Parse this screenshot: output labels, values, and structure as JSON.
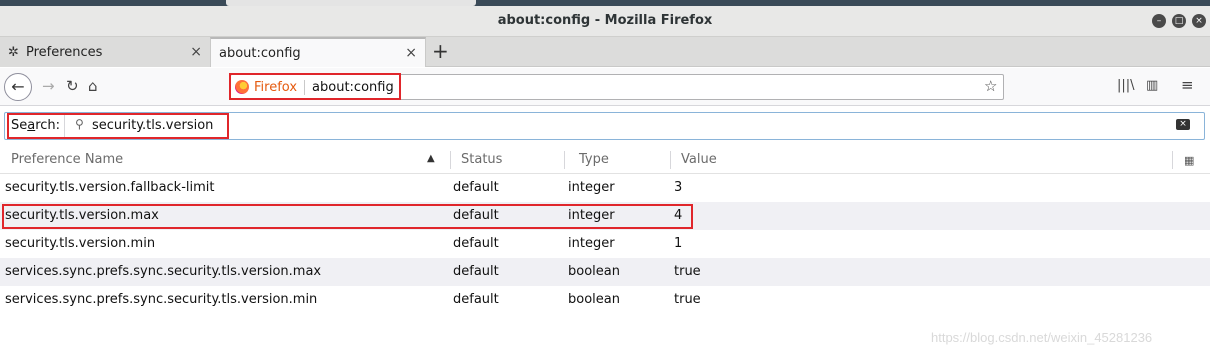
{
  "window": {
    "title": "about:config - Mozilla Firefox",
    "controls": [
      "minimize",
      "maximize",
      "close"
    ]
  },
  "tabs": [
    {
      "label": "Preferences",
      "icon": "gear-icon",
      "active": false
    },
    {
      "label": "about:config",
      "icon": null,
      "active": true
    }
  ],
  "navbar": {
    "identity_label": "Firefox",
    "url": "about:config"
  },
  "search": {
    "label": "Search:",
    "label_accesskey": "a",
    "value": "security.tls.version"
  },
  "table": {
    "columns": [
      "Preference Name",
      "Status",
      "Type",
      "Value"
    ],
    "sort_column": "Preference Name",
    "rows": [
      {
        "name": "security.tls.version.fallback-limit",
        "status": "default",
        "type": "integer",
        "value": "3"
      },
      {
        "name": "security.tls.version.max",
        "status": "default",
        "type": "integer",
        "value": "4"
      },
      {
        "name": "security.tls.version.min",
        "status": "default",
        "type": "integer",
        "value": "1"
      },
      {
        "name": "services.sync.prefs.sync.security.tls.version.max",
        "status": "default",
        "type": "boolean",
        "value": "true"
      },
      {
        "name": "services.sync.prefs.sync.security.tls.version.min",
        "status": "default",
        "type": "boolean",
        "value": "true"
      }
    ]
  },
  "watermark": "https://blog.csdn.net/weixin_45281236",
  "colors": {
    "highlight": "#e0262b",
    "firefox_orange": "#e55b10",
    "alt_row": "#f0f0f4"
  }
}
